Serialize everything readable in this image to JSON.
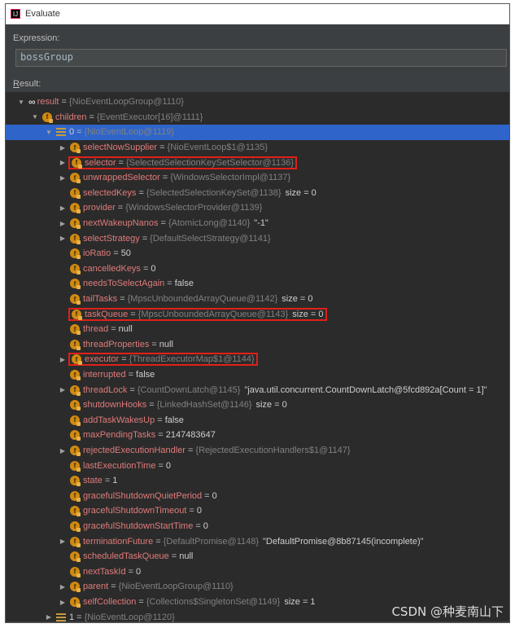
{
  "window": {
    "title": "Evaluate"
  },
  "expression": {
    "label": "Expression:",
    "value": "bossGroup"
  },
  "result": {
    "label_prefix": "R",
    "label_rest": "esult:"
  },
  "rows": [
    {
      "depth": 0,
      "arrow": "down",
      "icon": "oo",
      "name": "result",
      "plainName": false,
      "type": "{NioEventLoopGroup@1110}",
      "extra": "",
      "hl": false
    },
    {
      "depth": 1,
      "arrow": "down",
      "icon": "f",
      "name": "children",
      "type": "{EventExecutor[16]@1111}",
      "extra": "",
      "hl": false
    },
    {
      "depth": 2,
      "arrow": "down",
      "icon": "arr",
      "name": "0",
      "plainName": true,
      "type": "{NioEventLoop@1119}",
      "extra": "",
      "hl": false,
      "selected": true
    },
    {
      "depth": 3,
      "arrow": "right",
      "icon": "f",
      "name": "selectNowSupplier",
      "type": "{NioEventLoop$1@1135}",
      "extra": "",
      "hl": false
    },
    {
      "depth": 3,
      "arrow": "right",
      "icon": "f",
      "name": "selector",
      "type": "{SelectedSelectionKeySetSelector@1136}",
      "extra": "",
      "hl": true
    },
    {
      "depth": 3,
      "arrow": "right",
      "icon": "f",
      "name": "unwrappedSelector",
      "type": "{WindowsSelectorImpl@1137}",
      "extra": "",
      "hl": false
    },
    {
      "depth": 3,
      "arrow": "none",
      "icon": "f",
      "name": "selectedKeys",
      "type": "{SelectedSelectionKeySet@1138}",
      "extra": "size = 0",
      "hl": false
    },
    {
      "depth": 3,
      "arrow": "right",
      "icon": "f",
      "name": "provider",
      "type": "{WindowsSelectorProvider@1139}",
      "extra": "",
      "hl": false
    },
    {
      "depth": 3,
      "arrow": "right",
      "icon": "f",
      "name": "nextWakeupNanos",
      "type": "{AtomicLong@1140}",
      "extra": "\"-1\"",
      "hl": false
    },
    {
      "depth": 3,
      "arrow": "right",
      "icon": "f",
      "name": "selectStrategy",
      "type": "{DefaultSelectStrategy@1141}",
      "extra": "",
      "hl": false
    },
    {
      "depth": 3,
      "arrow": "none",
      "icon": "f",
      "name": "ioRatio",
      "type": "",
      "value": "50",
      "extra": "",
      "hl": false
    },
    {
      "depth": 3,
      "arrow": "none",
      "icon": "f",
      "name": "cancelledKeys",
      "type": "",
      "value": "0",
      "extra": "",
      "hl": false
    },
    {
      "depth": 3,
      "arrow": "none",
      "icon": "f",
      "name": "needsToSelectAgain",
      "type": "",
      "value": "false",
      "extra": "",
      "hl": false
    },
    {
      "depth": 3,
      "arrow": "none",
      "icon": "f",
      "name": "tailTasks",
      "type": "{MpscUnboundedArrayQueue@1142}",
      "extra": "size = 0",
      "hl": false
    },
    {
      "depth": 3,
      "arrow": "none",
      "icon": "f",
      "name": "taskQueue",
      "type": "{MpscUnboundedArrayQueue@1143}",
      "extra": "size = 0",
      "hl": true
    },
    {
      "depth": 3,
      "arrow": "none",
      "icon": "f",
      "name": "thread",
      "type": "",
      "value": "null",
      "extra": "",
      "hl": false
    },
    {
      "depth": 3,
      "arrow": "none",
      "icon": "f",
      "name": "threadProperties",
      "type": "",
      "value": "null",
      "extra": "",
      "hl": false
    },
    {
      "depth": 3,
      "arrow": "right",
      "icon": "f",
      "name": "executor",
      "type": "{ThreadExecutorMap$1@1144}",
      "extra": "",
      "hl": true
    },
    {
      "depth": 3,
      "arrow": "none",
      "icon": "f",
      "name": "interrupted",
      "type": "",
      "value": "false",
      "extra": "",
      "hl": false
    },
    {
      "depth": 3,
      "arrow": "right",
      "icon": "f",
      "name": "threadLock",
      "type": "{CountDownLatch@1145}",
      "extra": "\"java.util.concurrent.CountDownLatch@5fcd892a[Count = 1]\"",
      "hl": false
    },
    {
      "depth": 3,
      "arrow": "none",
      "icon": "f",
      "name": "shutdownHooks",
      "type": "{LinkedHashSet@1146}",
      "extra": "size = 0",
      "hl": false
    },
    {
      "depth": 3,
      "arrow": "none",
      "icon": "f",
      "name": "addTaskWakesUp",
      "type": "",
      "value": "false",
      "extra": "",
      "hl": false
    },
    {
      "depth": 3,
      "arrow": "none",
      "icon": "f",
      "name": "maxPendingTasks",
      "type": "",
      "value": "2147483647",
      "extra": "",
      "hl": false
    },
    {
      "depth": 3,
      "arrow": "right",
      "icon": "f",
      "name": "rejectedExecutionHandler",
      "type": "{RejectedExecutionHandlers$1@1147}",
      "extra": "",
      "hl": false
    },
    {
      "depth": 3,
      "arrow": "none",
      "icon": "f",
      "name": "lastExecutionTime",
      "type": "",
      "value": "0",
      "extra": "",
      "hl": false
    },
    {
      "depth": 3,
      "arrow": "none",
      "icon": "f",
      "name": "state",
      "type": "",
      "value": "1",
      "extra": "",
      "hl": false
    },
    {
      "depth": 3,
      "arrow": "none",
      "icon": "f",
      "name": "gracefulShutdownQuietPeriod",
      "type": "",
      "value": "0",
      "extra": "",
      "hl": false
    },
    {
      "depth": 3,
      "arrow": "none",
      "icon": "f",
      "name": "gracefulShutdownTimeout",
      "type": "",
      "value": "0",
      "extra": "",
      "hl": false
    },
    {
      "depth": 3,
      "arrow": "none",
      "icon": "f",
      "name": "gracefulShutdownStartTime",
      "type": "",
      "value": "0",
      "extra": "",
      "hl": false
    },
    {
      "depth": 3,
      "arrow": "right",
      "icon": "f",
      "name": "terminationFuture",
      "type": "{DefaultPromise@1148}",
      "extra": "\"DefaultPromise@8b87145(incomplete)\"",
      "hl": false
    },
    {
      "depth": 3,
      "arrow": "none",
      "icon": "f",
      "name": "scheduledTaskQueue",
      "type": "",
      "value": "null",
      "extra": "",
      "hl": false
    },
    {
      "depth": 3,
      "arrow": "none",
      "icon": "f",
      "name": "nextTaskId",
      "type": "",
      "value": "0",
      "extra": "",
      "hl": false
    },
    {
      "depth": 3,
      "arrow": "right",
      "icon": "f",
      "name": "parent",
      "type": "{NioEventLoopGroup@1110}",
      "extra": "",
      "hl": false
    },
    {
      "depth": 3,
      "arrow": "right",
      "icon": "f",
      "name": "selfCollection",
      "type": "{Collections$SingletonSet@1149}",
      "extra": "size = 1",
      "hl": false
    },
    {
      "depth": 2,
      "arrow": "right",
      "icon": "arr",
      "name": "1",
      "plainName": true,
      "type": "{NioEventLoop@1120}",
      "extra": "",
      "hl": false
    }
  ],
  "watermark": "CSDN @种麦南山下",
  "colors": {
    "field_name": "#e07b7b",
    "type_text": "#808080",
    "selected_row": "#2f65ca",
    "highlight_box": "#e0201a",
    "field_icon": "#d08a12"
  }
}
